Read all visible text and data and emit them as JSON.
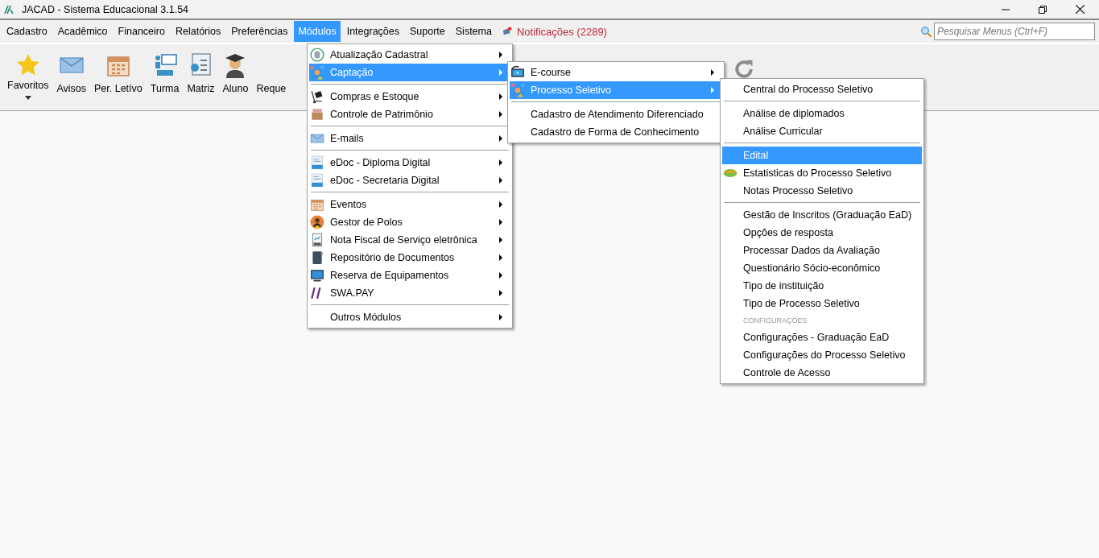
{
  "window": {
    "title": "JACAD - Sistema Educacional 3.1.54"
  },
  "menubar": [
    {
      "label": "Cadastro",
      "selected": false
    },
    {
      "label": "Acadêmico",
      "selected": false
    },
    {
      "label": "Financeiro",
      "selected": false
    },
    {
      "label": "Relatórios",
      "selected": false
    },
    {
      "label": "Preferências",
      "selected": false
    },
    {
      "label": "Módulos",
      "selected": true
    },
    {
      "label": "Integrações",
      "selected": false
    },
    {
      "label": "Suporte",
      "selected": false
    },
    {
      "label": "Sistema",
      "selected": false
    }
  ],
  "notifications": "Notificações (2289)",
  "search": {
    "placeholder": "Pesquisar Menus (Ctrl+F)"
  },
  "toolbar": [
    {
      "label": "Favoritos",
      "has_dropdown": true
    },
    {
      "label": "Avisos",
      "has_dropdown": false
    },
    {
      "label": "Per. Letívo",
      "has_dropdown": false
    },
    {
      "label": "Turma",
      "has_dropdown": false
    },
    {
      "label": "Matriz",
      "has_dropdown": false
    },
    {
      "label": "Aluno",
      "has_dropdown": false
    },
    {
      "label": "Reque",
      "has_dropdown": false
    }
  ],
  "menus": [
    {
      "items": [
        {
          "kind": "item",
          "label": "Atualização Cadastral",
          "has_submenu": true,
          "selected": false
        },
        {
          "kind": "item",
          "label": "Captação",
          "has_submenu": true,
          "selected": true
        },
        {
          "kind": "separator"
        },
        {
          "kind": "item",
          "label": "Compras e Estoque",
          "has_submenu": true,
          "selected": false
        },
        {
          "kind": "item",
          "label": "Controle de Patrimônio",
          "has_submenu": true,
          "selected": false
        },
        {
          "kind": "separator"
        },
        {
          "kind": "item",
          "label": "E-mails",
          "has_submenu": true,
          "selected": false
        },
        {
          "kind": "separator"
        },
        {
          "kind": "item",
          "label": "eDoc - Diploma Digital",
          "has_submenu": true,
          "selected": false
        },
        {
          "kind": "item",
          "label": "eDoc - Secretaria Digital",
          "has_submenu": true,
          "selected": false
        },
        {
          "kind": "separator"
        },
        {
          "kind": "item",
          "label": "Eventos",
          "has_submenu": true,
          "selected": false
        },
        {
          "kind": "item",
          "label": "Gestor de Polos",
          "has_submenu": true,
          "selected": false
        },
        {
          "kind": "item",
          "label": "Nota Fiscal de Serviço eletrônica",
          "has_submenu": true,
          "selected": false
        },
        {
          "kind": "item",
          "label": "Repositório de Documentos",
          "has_submenu": true,
          "selected": false
        },
        {
          "kind": "item",
          "label": "Reserva de Equipamentos",
          "has_submenu": true,
          "selected": false
        },
        {
          "kind": "item",
          "label": "SWA.PAY",
          "has_submenu": true,
          "selected": false
        },
        {
          "kind": "separator"
        },
        {
          "kind": "item",
          "label": "Outros Módulos",
          "has_submenu": true,
          "selected": false
        }
      ]
    },
    {
      "items": [
        {
          "kind": "item",
          "label": "E-course",
          "has_submenu": true,
          "selected": false
        },
        {
          "kind": "item",
          "label": "Processo Seletivo",
          "has_submenu": true,
          "selected": true
        },
        {
          "kind": "separator"
        },
        {
          "kind": "item",
          "label": "Cadastro de Atendimento Diferenciado",
          "has_submenu": false,
          "selected": false
        },
        {
          "kind": "item",
          "label": "Cadastro de Forma de Conhecimento",
          "has_submenu": false,
          "selected": false
        }
      ]
    },
    {
      "items": [
        {
          "kind": "item",
          "label": "Central do Processo Seletivo",
          "has_submenu": false,
          "selected": false
        },
        {
          "kind": "separator"
        },
        {
          "kind": "item",
          "label": "Análise de diplomados",
          "has_submenu": false,
          "selected": false
        },
        {
          "kind": "item",
          "label": "Análise Curricular",
          "has_submenu": false,
          "selected": false
        },
        {
          "kind": "separator"
        },
        {
          "kind": "item",
          "label": "Edital",
          "has_submenu": false,
          "selected": true
        },
        {
          "kind": "item",
          "label": "Estatisticas do Processo Seletivo",
          "has_submenu": false,
          "selected": false
        },
        {
          "kind": "item",
          "label": "Notas Processo Seletivo",
          "has_submenu": false,
          "selected": false
        },
        {
          "kind": "separator"
        },
        {
          "kind": "item",
          "label": "Gestão de Inscritos (Graduação EaD)",
          "has_submenu": false,
          "selected": false
        },
        {
          "kind": "item",
          "label": "Opções de resposta",
          "has_submenu": false,
          "selected": false
        },
        {
          "kind": "item",
          "label": "Processar Dados da Avaliação",
          "has_submenu": false,
          "selected": false
        },
        {
          "kind": "item",
          "label": "Questionário Sócio-econômico",
          "has_submenu": false,
          "selected": false
        },
        {
          "kind": "item",
          "label": "Tipo de instituição",
          "has_submenu": false,
          "selected": false
        },
        {
          "kind": "item",
          "label": "Tipo de Processo Seletivo",
          "has_submenu": false,
          "selected": false
        },
        {
          "kind": "header",
          "label": "CONFIGURAÇÕES"
        },
        {
          "kind": "item",
          "label": "Configurações - Graduação EaD",
          "has_submenu": false,
          "selected": false
        },
        {
          "kind": "item",
          "label": "Configurações do Processo Seletivo",
          "has_submenu": false,
          "selected": false
        },
        {
          "kind": "item",
          "label": "Controle de Acesso",
          "has_submenu": false,
          "selected": false
        }
      ]
    }
  ]
}
